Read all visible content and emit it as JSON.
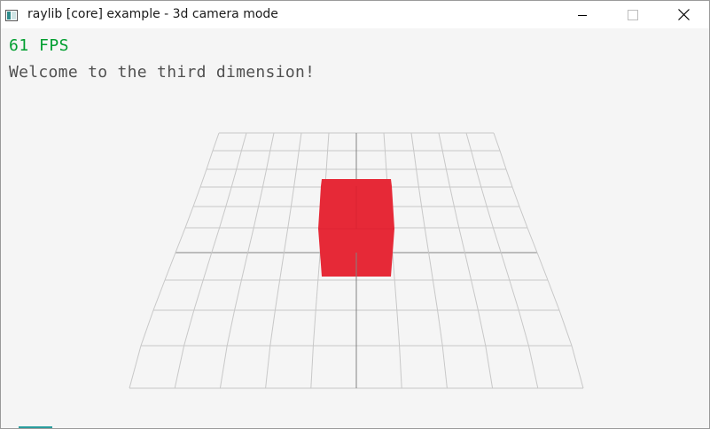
{
  "window": {
    "title": "raylib [core] example - 3d camera mode",
    "controls": {
      "minimize_icon": "minimize-icon",
      "maximize_icon": "maximize-icon",
      "close_icon": "close-icon"
    }
  },
  "overlay": {
    "fps": "61 FPS",
    "message": "Welcome to the third dimension!"
  },
  "scene": {
    "background": "#f5f5f5",
    "grid_color": "#c8c8c8",
    "axis_color": "#828282",
    "cube_color": "#e62937",
    "fps_color": "#009e2f",
    "text_color": "#505050"
  }
}
